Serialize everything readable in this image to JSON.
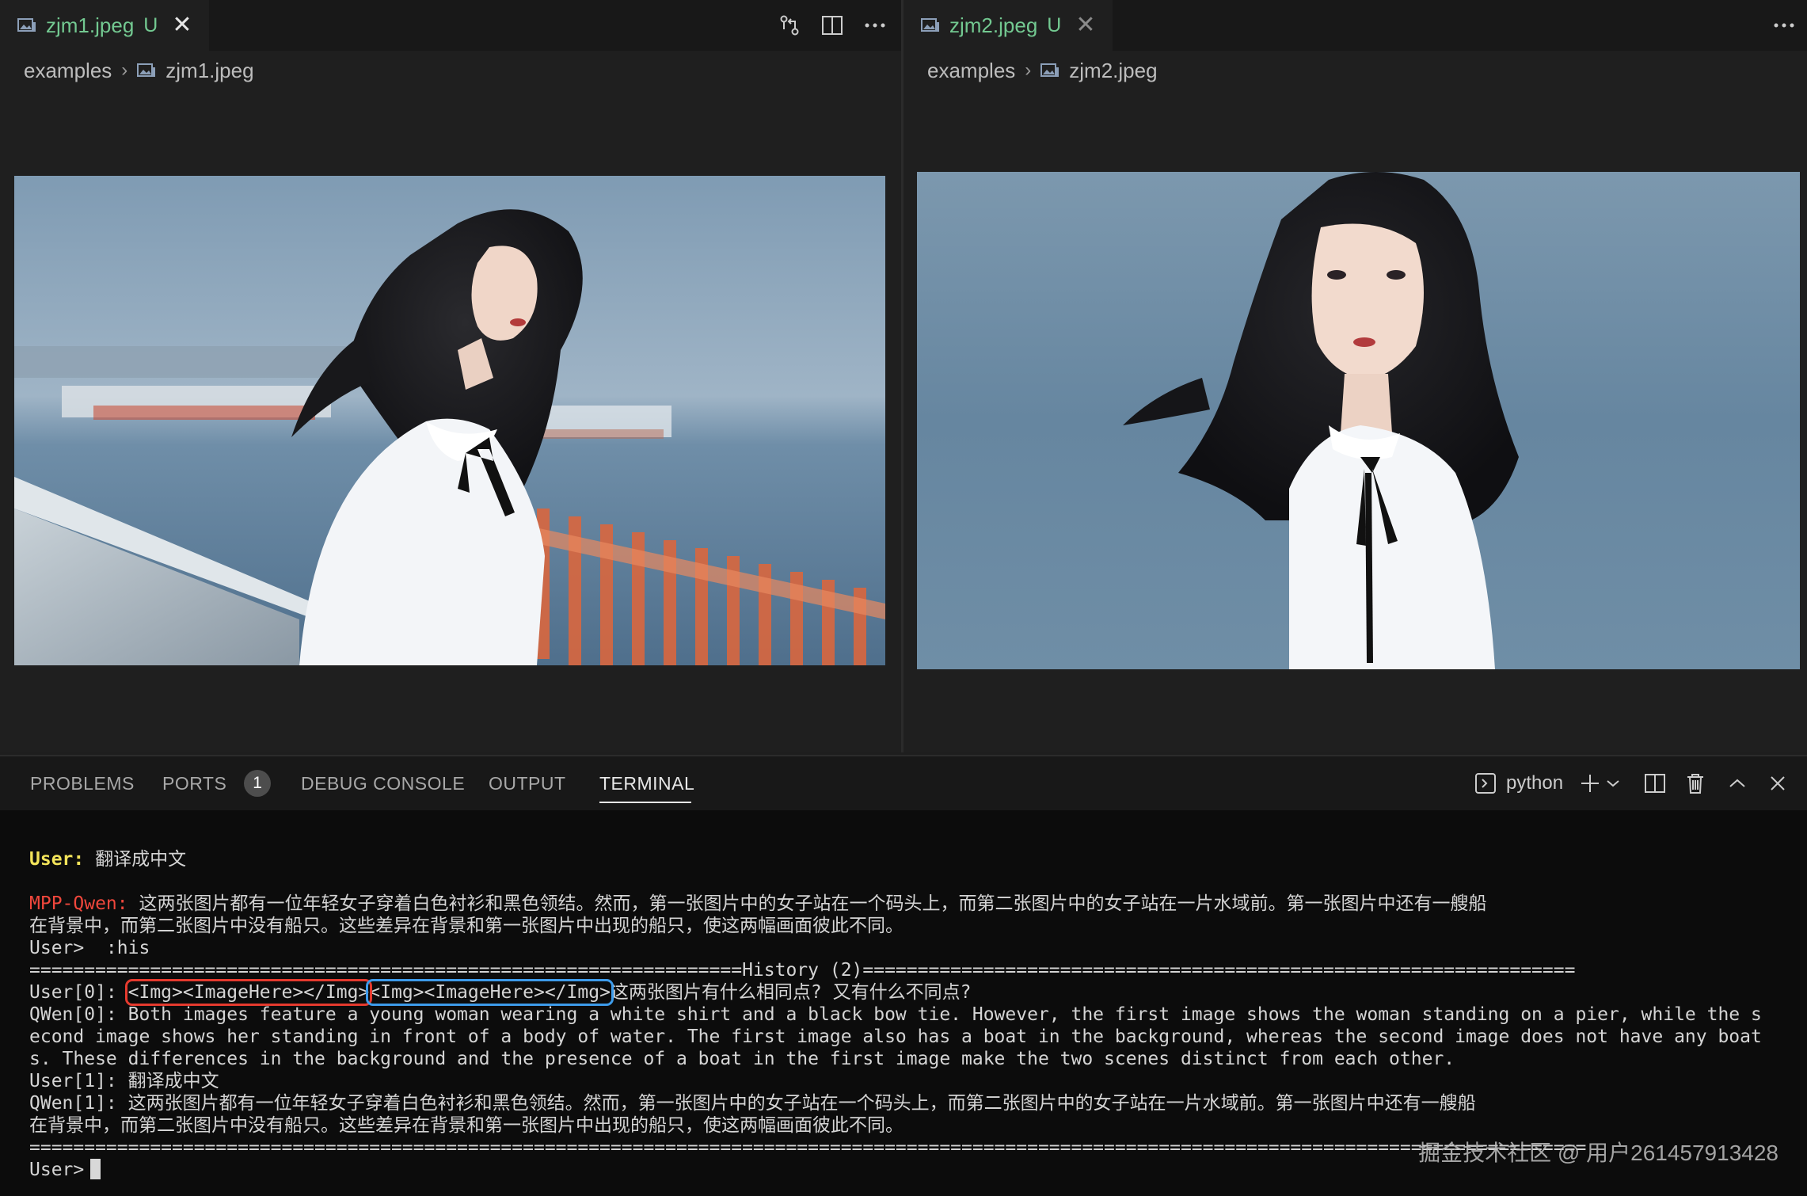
{
  "editor": {
    "left": {
      "tab": {
        "name": "zjm1.jpeg",
        "status": "U",
        "close": "✕"
      },
      "breadcrumb": {
        "folder": "examples",
        "sep": "›",
        "file": "zjm1.jpeg"
      },
      "actions": [
        "open-changes-icon",
        "split-editor-icon",
        "more-actions-icon"
      ]
    },
    "right": {
      "tab": {
        "name": "zjm2.jpeg",
        "status": "U",
        "close": "✕"
      },
      "breadcrumb": {
        "folder": "examples",
        "sep": "›",
        "file": "zjm2.jpeg"
      },
      "actions": [
        "more-actions-icon"
      ]
    }
  },
  "panel": {
    "tabs": [
      {
        "label": "PROBLEMS"
      },
      {
        "label": "PORTS",
        "badge": "1"
      },
      {
        "label": "DEBUG CONSOLE"
      },
      {
        "label": "OUTPUT"
      },
      {
        "label": "TERMINAL",
        "active": true
      }
    ],
    "terminal_profile": "python",
    "actions": [
      "terminal-icon",
      "new-terminal-icon",
      "chevron-down-icon",
      "split-terminal-icon",
      "trash-icon",
      "maximize-panel-icon",
      "close-panel-icon"
    ]
  },
  "terminal": {
    "user_prompt_label": "User:",
    "user_prompt_text": " 翻译成中文",
    "mpp_label": "MPP-Qwen:",
    "mpp_text_1": " 这两张图片都有一位年轻女子穿着白色衬衫和黑色领结。然而，第一张图片中的女子站在一个码头上，而第二张图片中的女子站在一片水域前。第一张图片中还有一艘船",
    "mpp_text_2": "在背景中，而第二张图片中没有船只。这些差异在背景和第一张图片中出现的船只，使这两幅画面彼此不同。",
    "his_cmd": "User>  :his",
    "history_line": "=================================================================History (2)=================================================================",
    "user0_prefix": "User[0]:",
    "user0_img1": "<Img><ImageHere></Img>",
    "user0_img2": "<Img><ImageHere></Img>",
    "user0_text": "这两张图片有什么相同点? 又有什么不同点?",
    "qwen0_1": "QWen[0]: Both images feature a young woman wearing a white shirt and a black bow tie. However, the first image shows the woman standing on a pier, while the s",
    "qwen0_2": "econd image shows her standing in front of a body of water. The first image also has a boat in the background, whereas the second image does not have any boat",
    "qwen0_3": "s. These differences in the background and the presence of a boat in the first image make the two scenes distinct from each other.",
    "user1": "User[1]: 翻译成中文",
    "qwen1_1": "QWen[1]: 这两张图片都有一位年轻女子穿着白色衬衫和黑色领结。然而，第一张图片中的女子站在一个码头上，而第二张图片中的女子站在一片水域前。第一张图片中还有一艘船",
    "qwen1_2": "在背景中，而第二张图片中没有船只。这些差异在背景和第一张图片中出现的船只，使这两幅画面彼此不同。",
    "end_line": "==============================================================================================================================================",
    "final_prompt": "User>"
  },
  "watermark": "掘金技术社区 @ 用户261457913428",
  "colors": {
    "modified": "#73c991",
    "user_label": "#f2e35a",
    "mpp_label": "#f0473c",
    "box_red": "#e53a2e",
    "box_blue": "#3d9bea"
  }
}
